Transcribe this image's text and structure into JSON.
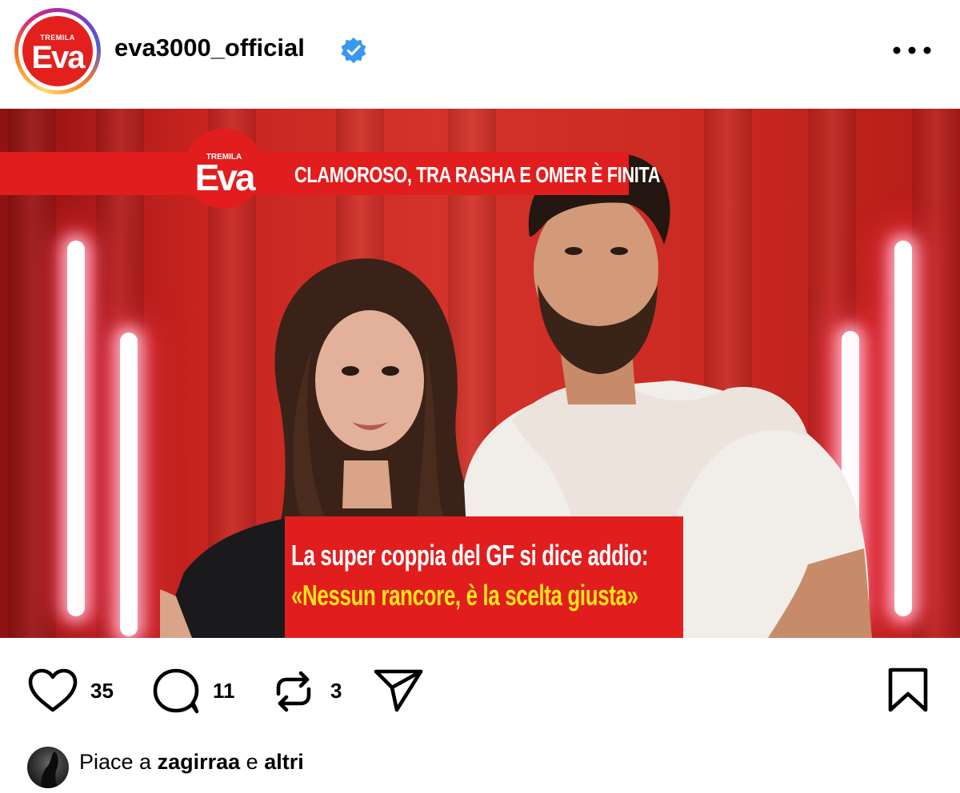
{
  "colors": {
    "brand_red": "#e21d1d",
    "caption_yellow": "#ffe31a",
    "verified_blue": "#3897f0",
    "background": "#ffffff"
  },
  "header": {
    "avatar_logo_small": "TREMILA",
    "avatar_logo_big": "Eva",
    "username": "eva3000_official",
    "verified_icon": "verified-badge-icon",
    "more_icon": "more-horizontal-icon"
  },
  "post": {
    "banner_logo_small": "TREMILA",
    "banner_logo_big": "Eva",
    "banner_headline": "CLAMOROSO, TRA RASHA E OMER È FINITA",
    "caption_line1": "La super coppia del GF si dice addio:",
    "caption_line2": "«Nessun rancore, è la scelta giusta»"
  },
  "actions": {
    "like_icon": "heart-icon",
    "like_count": "35",
    "comment_icon": "comment-icon",
    "comment_count": "11",
    "repost_icon": "repost-icon",
    "repost_count": "3",
    "share_icon": "send-icon",
    "save_icon": "bookmark-icon"
  },
  "likes": {
    "prefix": "Piace a",
    "user": "zagirraa",
    "joiner": "e",
    "others": "altri"
  }
}
